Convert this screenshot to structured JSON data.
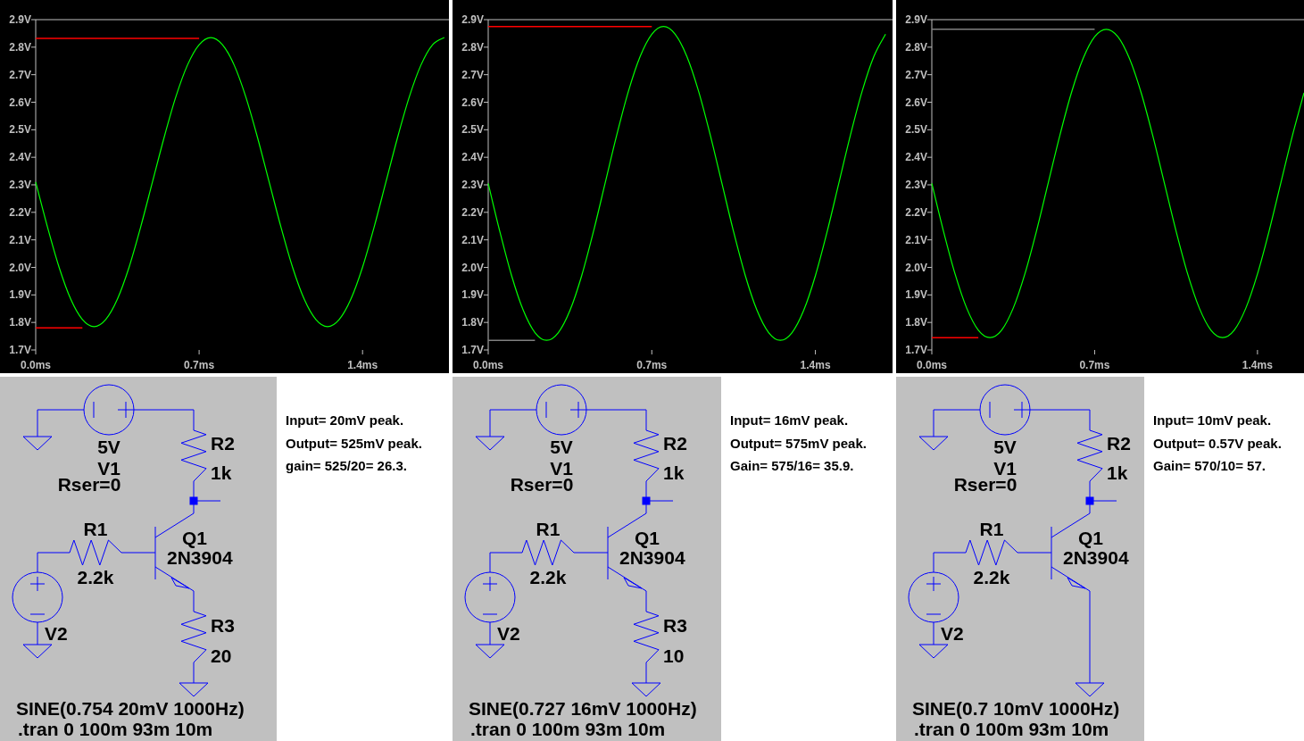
{
  "panels": [
    {
      "chart_data": {
        "type": "line",
        "xlim": [
          0,
          1.77
        ],
        "ylim": [
          1.7,
          2.9
        ],
        "x": [
          0,
          0.05,
          0.1,
          0.15,
          0.2,
          0.25,
          0.3,
          0.35,
          0.4,
          0.45,
          0.5,
          0.55,
          0.6,
          0.65,
          0.7,
          0.75,
          0.8,
          0.85,
          0.9,
          0.95,
          1.0,
          1.05,
          1.1,
          1.15,
          1.2,
          1.25,
          1.3,
          1.35,
          1.4,
          1.45,
          1.5,
          1.55,
          1.6,
          1.65,
          1.7,
          1.75
        ],
        "series": [
          {
            "color": "#00ff00",
            "values": [
              2.31,
              2.148,
              2.001,
              1.885,
              1.811,
              1.785,
              1.811,
              1.885,
              2.001,
              2.148,
              2.31,
              2.472,
              2.619,
              2.735,
              2.809,
              2.835,
              2.809,
              2.735,
              2.619,
              2.472,
              2.31,
              2.148,
              2.001,
              1.885,
              1.811,
              1.785,
              1.811,
              1.885,
              2.001,
              2.148,
              2.31,
              2.472,
              2.619,
              2.735,
              2.809,
              2.835
            ]
          },
          {
            "color": "#ff0000",
            "values": [
              2.832,
              2.832,
              2.832,
              2.832,
              2.832,
              2.832,
              2.832,
              2.832,
              2.832,
              2.832,
              2.832,
              2.832,
              2.832,
              2.832,
              2.832,
              null,
              null,
              null,
              null,
              null,
              null,
              null,
              null,
              null,
              null,
              null,
              null,
              null,
              null,
              null,
              null,
              null,
              null,
              null,
              null,
              null
            ]
          },
          {
            "color": "#ff0000",
            "values": [
              1.78,
              1.78,
              1.78,
              1.78,
              1.78,
              null,
              null,
              null,
              null,
              null,
              null,
              null,
              null,
              null,
              null,
              null,
              null,
              null,
              null,
              null,
              null,
              null,
              null,
              null,
              null,
              null,
              null,
              null,
              null,
              null,
              null,
              null,
              null,
              null,
              null,
              null
            ]
          }
        ],
        "xticks": [
          {
            "value": 0,
            "label": "0.0ms"
          },
          {
            "value": 0.7,
            "label": "0.7ms"
          },
          {
            "value": 1.4,
            "label": "1.4ms"
          }
        ],
        "yticks": [
          {
            "value": 1.7,
            "label": "1.7V"
          },
          {
            "value": 1.8,
            "label": "1.8V"
          },
          {
            "value": 1.9,
            "label": "1.9V"
          },
          {
            "value": 2.0,
            "label": "2.0V"
          },
          {
            "value": 2.1,
            "label": "2.1V"
          },
          {
            "value": 2.2,
            "label": "2.2V"
          },
          {
            "value": 2.3,
            "label": "2.3V"
          },
          {
            "value": 2.4,
            "label": "2.4V"
          },
          {
            "value": 2.5,
            "label": "2.5V"
          },
          {
            "value": 2.6,
            "label": "2.6V"
          },
          {
            "value": 2.7,
            "label": "2.7V"
          },
          {
            "value": 2.8,
            "label": "2.8V"
          },
          {
            "value": 2.9,
            "label": "2.9V"
          }
        ]
      },
      "schematic": {
        "v1_value": "5V",
        "v1_name": "V1",
        "v1_param": "Rser=0",
        "r2_name": "R2",
        "r2_value": "1k",
        "r1_name": "R1",
        "r1_value": "2.2k",
        "q1_name": "Q1",
        "q1_model": "2N3904",
        "v2_name": "V2",
        "r3_name": "R3",
        "r3_value": "20",
        "source": "SINE(0.754 20mV 1000Hz)",
        "directive": ".tran 0 100m 93m 10m"
      },
      "notes": [
        "Input= 20mV peak.",
        "Output= 525mV peak.",
        "gain= 525/20= 26.3."
      ]
    },
    {
      "chart_data": {
        "type": "line",
        "xlim": [
          0,
          1.73
        ],
        "ylim": [
          1.7,
          2.9
        ],
        "x": [
          0,
          0.05,
          0.1,
          0.15,
          0.2,
          0.25,
          0.3,
          0.35,
          0.4,
          0.45,
          0.5,
          0.55,
          0.6,
          0.65,
          0.7,
          0.75,
          0.8,
          0.85,
          0.9,
          0.95,
          1.0,
          1.05,
          1.1,
          1.15,
          1.2,
          1.25,
          1.3,
          1.35,
          1.4,
          1.45,
          1.5,
          1.55,
          1.6,
          1.65,
          1.7
        ],
        "series": [
          {
            "color": "#00ff00",
            "values": [
              2.305,
              2.129,
              1.97,
              1.844,
              1.763,
              1.735,
              1.763,
              1.844,
              1.97,
              2.129,
              2.305,
              2.481,
              2.64,
              2.766,
              2.847,
              2.875,
              2.847,
              2.766,
              2.64,
              2.481,
              2.305,
              2.129,
              1.97,
              1.844,
              1.763,
              1.735,
              1.763,
              1.844,
              1.97,
              2.129,
              2.305,
              2.481,
              2.64,
              2.766,
              2.847
            ]
          },
          {
            "color": "#ff0000",
            "values": [
              2.875,
              2.875,
              2.875,
              2.875,
              2.875,
              2.875,
              2.875,
              2.875,
              2.875,
              2.875,
              2.875,
              2.875,
              2.875,
              2.875,
              2.875,
              null,
              null,
              null,
              null,
              null,
              null,
              null,
              null,
              null,
              null,
              null,
              null,
              null,
              null,
              null,
              null,
              null,
              null,
              null,
              null
            ]
          },
          {
            "color": "#808080",
            "values": [
              1.735,
              1.735,
              1.735,
              1.735,
              1.735,
              null,
              null,
              null,
              null,
              null,
              null,
              null,
              null,
              null,
              null,
              null,
              null,
              null,
              null,
              null,
              null,
              null,
              null,
              null,
              null,
              null,
              null,
              null,
              null,
              null,
              null,
              null,
              null,
              null,
              null
            ]
          }
        ],
        "xticks": [
          {
            "value": 0,
            "label": "0.0ms"
          },
          {
            "value": 0.7,
            "label": "0.7ms"
          },
          {
            "value": 1.4,
            "label": "1.4ms"
          }
        ],
        "yticks": [
          {
            "value": 1.7,
            "label": "1.7V"
          },
          {
            "value": 1.8,
            "label": "1.8V"
          },
          {
            "value": 1.9,
            "label": "1.9V"
          },
          {
            "value": 2.0,
            "label": "2.0V"
          },
          {
            "value": 2.1,
            "label": "2.1V"
          },
          {
            "value": 2.2,
            "label": "2.2V"
          },
          {
            "value": 2.3,
            "label": "2.3V"
          },
          {
            "value": 2.4,
            "label": "2.4V"
          },
          {
            "value": 2.5,
            "label": "2.5V"
          },
          {
            "value": 2.6,
            "label": "2.6V"
          },
          {
            "value": 2.7,
            "label": "2.7V"
          },
          {
            "value": 2.8,
            "label": "2.8V"
          },
          {
            "value": 2.9,
            "label": "2.9V"
          }
        ]
      },
      "schematic": {
        "v1_value": "5V",
        "v1_name": "V1",
        "v1_param": "Rser=0",
        "r2_name": "R2",
        "r2_value": "1k",
        "r1_name": "R1",
        "r1_value": "2.2k",
        "q1_name": "Q1",
        "q1_model": "2N3904",
        "v2_name": "V2",
        "r3_name": "R3",
        "r3_value": "10",
        "source": "SINE(0.727 16mV 1000Hz)",
        "directive": ".tran 0 100m 93m 10m"
      },
      "notes": [
        "Input= 16mV peak.",
        "Output= 575mV peak.",
        "Gain= 575/16= 35.9."
      ]
    },
    {
      "chart_data": {
        "type": "line",
        "xlim": [
          0,
          1.6
        ],
        "ylim": [
          1.7,
          2.9
        ],
        "x": [
          0,
          0.05,
          0.1,
          0.15,
          0.2,
          0.25,
          0.3,
          0.35,
          0.4,
          0.45,
          0.5,
          0.55,
          0.6,
          0.65,
          0.7,
          0.75,
          0.8,
          0.85,
          0.9,
          0.95,
          1.0,
          1.05,
          1.1,
          1.15,
          1.2,
          1.25,
          1.3,
          1.35,
          1.4,
          1.45,
          1.5,
          1.55,
          1.6
        ],
        "series": [
          {
            "color": "#00ff00",
            "values": [
              2.305,
              2.132,
              1.976,
              1.852,
              1.772,
              1.745,
              1.772,
              1.852,
              1.976,
              2.132,
              2.305,
              2.478,
              2.634,
              2.758,
              2.838,
              2.865,
              2.838,
              2.758,
              2.634,
              2.478,
              2.305,
              2.132,
              1.976,
              1.852,
              1.772,
              1.745,
              1.772,
              1.852,
              1.976,
              2.132,
              2.305,
              2.478,
              2.634
            ]
          },
          {
            "color": "#808080",
            "values": [
              2.865,
              2.865,
              2.865,
              2.865,
              2.865,
              2.865,
              2.865,
              2.865,
              2.865,
              2.865,
              2.865,
              2.865,
              2.865,
              2.865,
              2.865,
              null,
              null,
              null,
              null,
              null,
              null,
              null,
              null,
              null,
              null,
              null,
              null,
              null,
              null,
              null,
              null,
              null,
              null
            ]
          },
          {
            "color": "#ff0000",
            "values": [
              1.745,
              1.745,
              1.745,
              1.745,
              1.745,
              null,
              null,
              null,
              null,
              null,
              null,
              null,
              null,
              null,
              null,
              null,
              null,
              null,
              null,
              null,
              null,
              null,
              null,
              null,
              null,
              null,
              null,
              null,
              null,
              null,
              null,
              null,
              null
            ]
          }
        ],
        "xticks": [
          {
            "value": 0,
            "label": "0.0ms"
          },
          {
            "value": 0.7,
            "label": "0.7ms"
          },
          {
            "value": 1.4,
            "label": "1.4ms"
          }
        ],
        "yticks": [
          {
            "value": 1.7,
            "label": "1.7V"
          },
          {
            "value": 1.8,
            "label": "1.8V"
          },
          {
            "value": 1.9,
            "label": "1.9V"
          },
          {
            "value": 2.0,
            "label": "2.0V"
          },
          {
            "value": 2.1,
            "label": "2.1V"
          },
          {
            "value": 2.2,
            "label": "2.2V"
          },
          {
            "value": 2.3,
            "label": "2.3V"
          },
          {
            "value": 2.4,
            "label": "2.4V"
          },
          {
            "value": 2.5,
            "label": "2.5V"
          },
          {
            "value": 2.6,
            "label": "2.6V"
          },
          {
            "value": 2.7,
            "label": "2.7V"
          },
          {
            "value": 2.8,
            "label": "2.8V"
          },
          {
            "value": 2.9,
            "label": "2.9V"
          }
        ]
      },
      "schematic": {
        "v1_value": "5V",
        "v1_name": "V1",
        "v1_param": "Rser=0",
        "r2_name": "R2",
        "r2_value": "1k",
        "r1_name": "R1",
        "r1_value": "2.2k",
        "q1_name": "Q1",
        "q1_model": "2N3904",
        "v2_name": "V2",
        "source": "SINE(0.7 10mV 1000Hz)",
        "directive": ".tran 0 100m 93m 10m"
      },
      "notes": [
        "Input= 10mV peak.",
        "Output= 0.57V peak.",
        "Gain= 570/10= 57."
      ]
    }
  ]
}
